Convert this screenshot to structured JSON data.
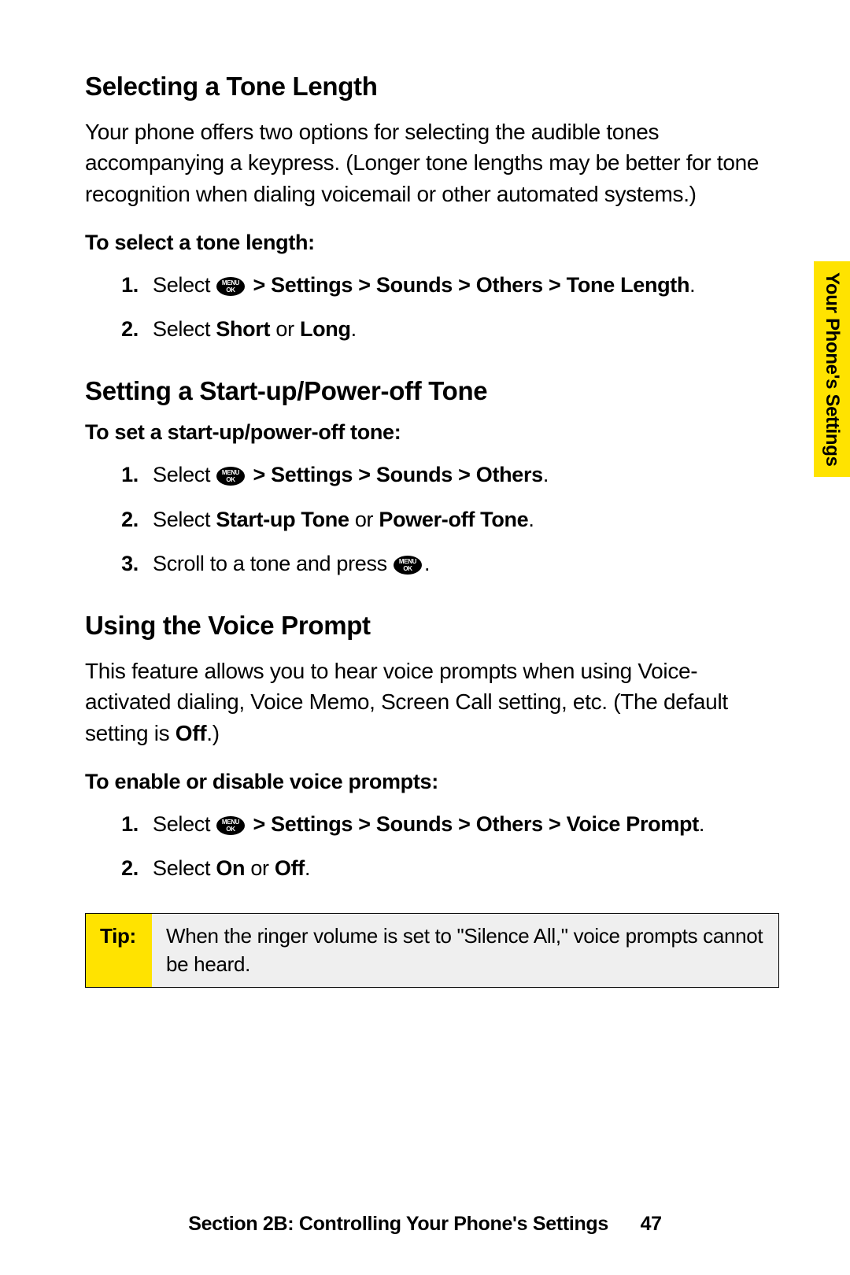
{
  "sideTab": "Your Phone's Settings",
  "footer": {
    "section": "Section 2B: Controlling Your Phone's Settings",
    "page": "47"
  },
  "s1": {
    "heading": "Selecting a Tone Length",
    "para": "Your phone offers two options for selecting the audible tones accompanying a keypress. (Longer tone lengths may be better for tone recognition when dialing voicemail or other automated systems.)",
    "sub": "To select a tone length:",
    "step1_num": "1.",
    "step1_a": "Select ",
    "step1_b": " > Settings > Sounds > Others > Tone Length",
    "step2_num": "2.",
    "step2_a": "Select ",
    "step2_b": "Short",
    "step2_c": " or ",
    "step2_d": "Long"
  },
  "s2": {
    "heading": "Setting a Start-up/Power-off Tone",
    "sub": "To set a start-up/power-off tone:",
    "step1_num": "1.",
    "step1_a": "Select ",
    "step1_b": " > Settings > Sounds > Others",
    "step2_num": "2.",
    "step2_a": "Select ",
    "step2_b": "Start-up Tone",
    "step2_c": " or ",
    "step2_d": "Power-off Tone",
    "step3_num": "3.",
    "step3_a": "Scroll to a tone and press "
  },
  "s3": {
    "heading": "Using the Voice Prompt",
    "para1": "This feature allows you to hear voice prompts when using Voice-activated dialing, Voice Memo, Screen Call setting, etc. (The default setting is ",
    "para1b": "Off",
    "para1c": ".)",
    "sub": "To enable or disable voice prompts:",
    "step1_num": "1.",
    "step1_a": "Select ",
    "step1_b": " > Settings > Sounds > Others > Voice Prompt",
    "step2_num": "2.",
    "step2_a": "Select ",
    "step2_b": "On",
    "step2_c": " or ",
    "step2_d": "Off"
  },
  "tip": {
    "label": "Tip:",
    "body": "When the ringer volume is set to \"Silence All,\" voice prompts cannot be heard."
  }
}
